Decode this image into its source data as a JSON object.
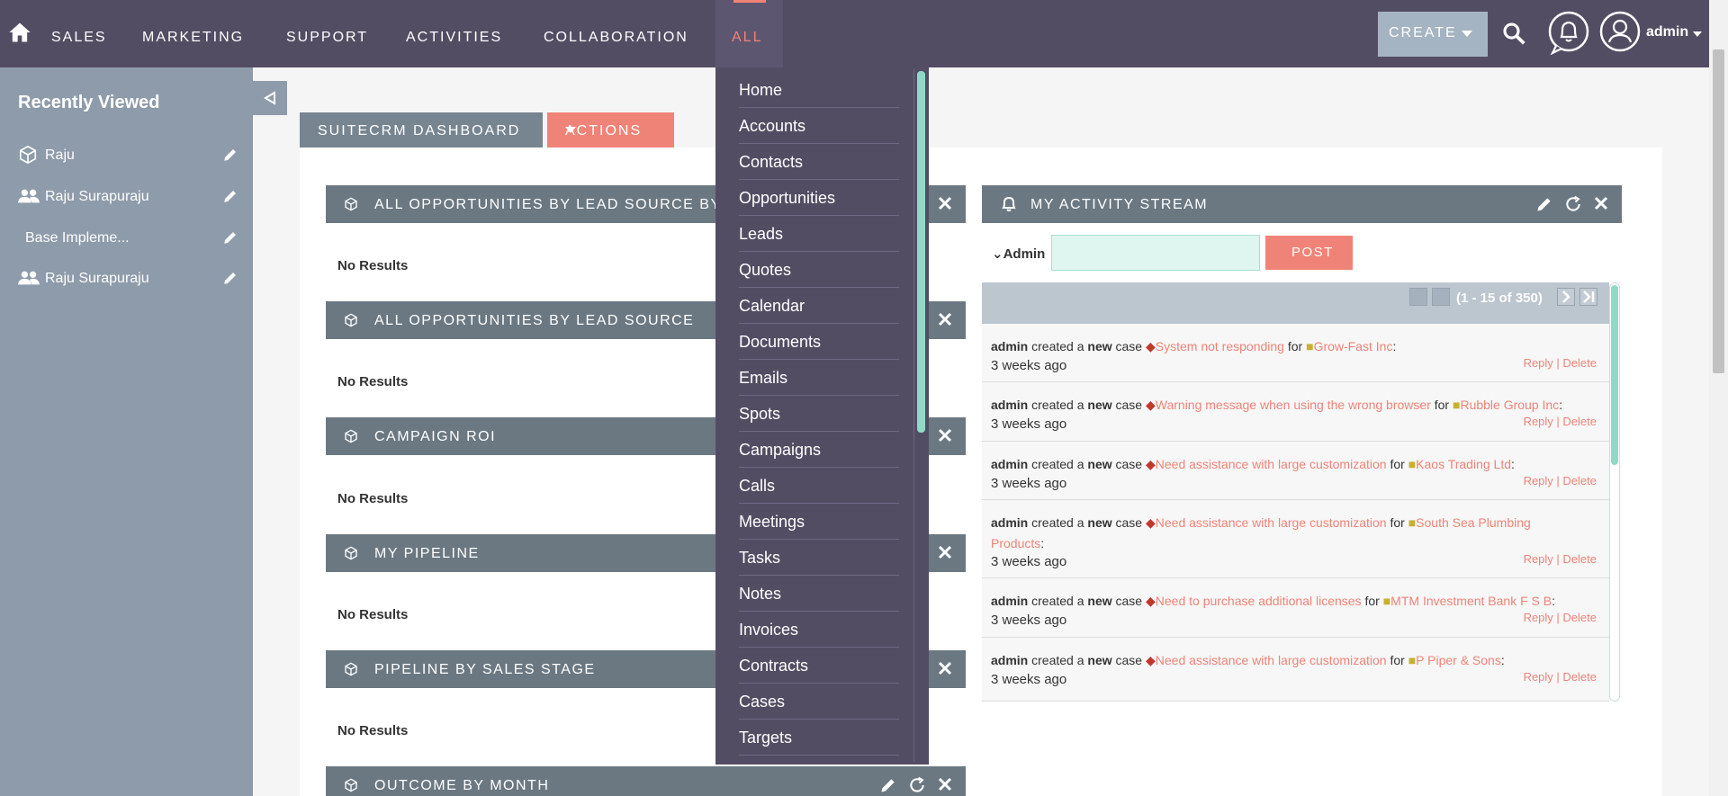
{
  "nav": {
    "items": [
      "SALES",
      "MARKETING",
      "SUPPORT",
      "ACTIVITIES",
      "COLLABORATION",
      "ALL"
    ],
    "active": "ALL",
    "create_label": "CREATE",
    "username": "admin"
  },
  "sidebar": {
    "title": "Recently Viewed",
    "items": [
      {
        "label": "Raju",
        "icon": "cube-icon"
      },
      {
        "label": "Raju Surapuraju",
        "icon": "users-icon"
      },
      {
        "label": "Base Impleme...",
        "icon": ""
      },
      {
        "label": "Raju Surapuraju",
        "icon": "users-icon"
      }
    ]
  },
  "tabs": {
    "dashboard": "SUITECRM DASHBOARD",
    "actions": "ACTIONS"
  },
  "dashlets": [
    {
      "title": "ALL OPPORTUNITIES BY LEAD SOURCE BY O",
      "body": "No Results"
    },
    {
      "title": "ALL OPPORTUNITIES BY LEAD SOURCE",
      "body": "No Results"
    },
    {
      "title": "CAMPAIGN ROI",
      "body": "No Results"
    },
    {
      "title": "MY PIPELINE",
      "body": "No Results"
    },
    {
      "title": "PIPELINE BY SALES STAGE",
      "body": "No Results"
    },
    {
      "title": "OUTCOME BY MONTH",
      "body": ""
    }
  ],
  "activity_stream": {
    "title": "MY ACTIVITY STREAM",
    "admin_label": "Admin",
    "post_label": "POST",
    "pager": "(1 - 15 of 350)",
    "reply_label": "Reply",
    "delete_label": "Delete",
    "items": [
      {
        "user": "admin",
        "verb": "created a",
        "new": "new",
        "type": "case",
        "subject": "System not responding",
        "for": "for",
        "account": "Grow-Fast Inc",
        "ago": "3 weeks ago"
      },
      {
        "user": "admin",
        "verb": "created a",
        "new": "new",
        "type": "case",
        "subject": "Warning message when using the wrong browser",
        "for": "for",
        "account": "Rubble Group Inc",
        "ago": "3 weeks ago"
      },
      {
        "user": "admin",
        "verb": "created a",
        "new": "new",
        "type": "case",
        "subject": "Need assistance with large customization",
        "for": "for",
        "account": "Kaos Trading Ltd",
        "ago": "3 weeks ago"
      },
      {
        "user": "admin",
        "verb": "created a",
        "new": "new",
        "type": "case",
        "subject": "Need assistance with large customization",
        "for": "for",
        "account": "South Sea Plumbing Products",
        "ago": "3 weeks ago"
      },
      {
        "user": "admin",
        "verb": "created a",
        "new": "new",
        "type": "case",
        "subject": "Need to purchase additional licenses",
        "for": "for",
        "account": "MTM Investment Bank F S B",
        "ago": "3 weeks ago"
      },
      {
        "user": "admin",
        "verb": "created a",
        "new": "new",
        "type": "case",
        "subject": "Need assistance with large customization",
        "for": "for",
        "account": "P Piper & Sons",
        "ago": "3 weeks ago"
      }
    ]
  },
  "all_menu": [
    "Home",
    "Accounts",
    "Contacts",
    "Opportunities",
    "Leads",
    "Quotes",
    "Calendar",
    "Documents",
    "Emails",
    "Spots",
    "Campaigns",
    "Calls",
    "Meetings",
    "Tasks",
    "Notes",
    "Invoices",
    "Contracts",
    "Cases",
    "Targets"
  ],
  "colors": {
    "nav_bg": "#534d64",
    "accent": "#f08377",
    "sidebar_bg": "#8e9bab",
    "dashlet_header": "#6b7882",
    "scroll_thumb": "#8fd9c6"
  }
}
